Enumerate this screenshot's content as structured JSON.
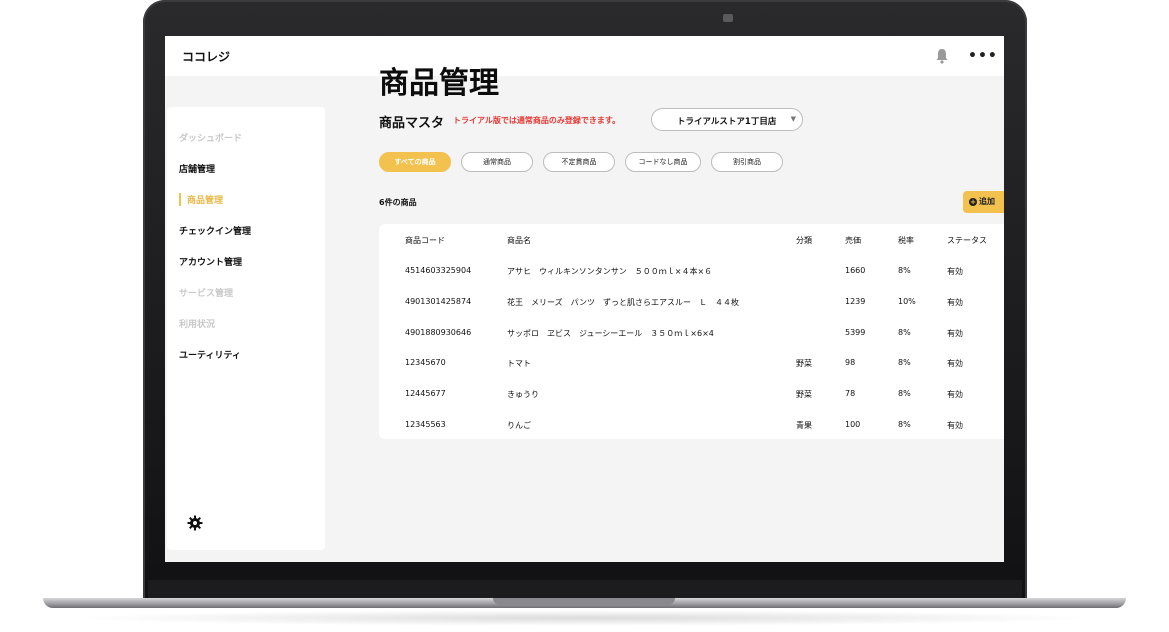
{
  "app": {
    "title": "ココレジ"
  },
  "header": {
    "title": "商品管理",
    "more_label": "•••"
  },
  "sidebar": {
    "items": [
      {
        "label": "ダッシュボード",
        "state": "disabled"
      },
      {
        "label": "店舗管理",
        "state": "normal"
      },
      {
        "label": "商品管理",
        "state": "active"
      },
      {
        "label": "チェックイン管理",
        "state": "normal"
      },
      {
        "label": "アカウント管理",
        "state": "normal"
      },
      {
        "label": "サービス管理",
        "state": "disabled"
      },
      {
        "label": "利用状況",
        "state": "disabled"
      },
      {
        "label": "ユーティリティ",
        "state": "normal"
      }
    ]
  },
  "section": {
    "title": "商品マスタ",
    "trial_note": "トライアル版では通常商品のみ登録できます。",
    "store_select": {
      "value": "トライアルストア1丁目店"
    }
  },
  "filters": [
    {
      "label": "すべての商品",
      "selected": true
    },
    {
      "label": "通常商品",
      "selected": false
    },
    {
      "label": "不定貫商品",
      "selected": false
    },
    {
      "label": "コードなし商品",
      "selected": false
    },
    {
      "label": "割引商品",
      "selected": false
    }
  ],
  "count_label": "6件の商品",
  "add_label": "追加",
  "table": {
    "columns": [
      "商品コード",
      "商品名",
      "分類",
      "売価",
      "税率",
      "ステータス"
    ],
    "rows": [
      [
        "4514603325904",
        "アサヒ　ウィルキンソンタンサン　５００ｍｌ×４本×６",
        "",
        "1660",
        "8%",
        "有効"
      ],
      [
        "4901301425874",
        "花王　メリーズ　パンツ　ずっと肌さらエアスルー　Ｌ　４４枚",
        "",
        "1239",
        "10%",
        "有効"
      ],
      [
        "4901880930646",
        "サッポロ　ヱビス　ジューシーエール　３５０ｍｌ×6×4",
        "",
        "5399",
        "8%",
        "有効"
      ],
      [
        "12345670",
        "トマト",
        "野菜",
        "98",
        "8%",
        "有効"
      ],
      [
        "12445677",
        "きゅうり",
        "野菜",
        "78",
        "8%",
        "有効"
      ],
      [
        "12345563",
        "りんご",
        "青果",
        "100",
        "8%",
        "有効"
      ]
    ]
  },
  "colors": {
    "accent": "#f2c14e",
    "warning": "#e53935",
    "background": "#f4f4f4"
  },
  "icons": {
    "notification": "bell-icon",
    "settings": "gear-icon",
    "more": "more-icon",
    "add": "plus-circle-icon"
  }
}
